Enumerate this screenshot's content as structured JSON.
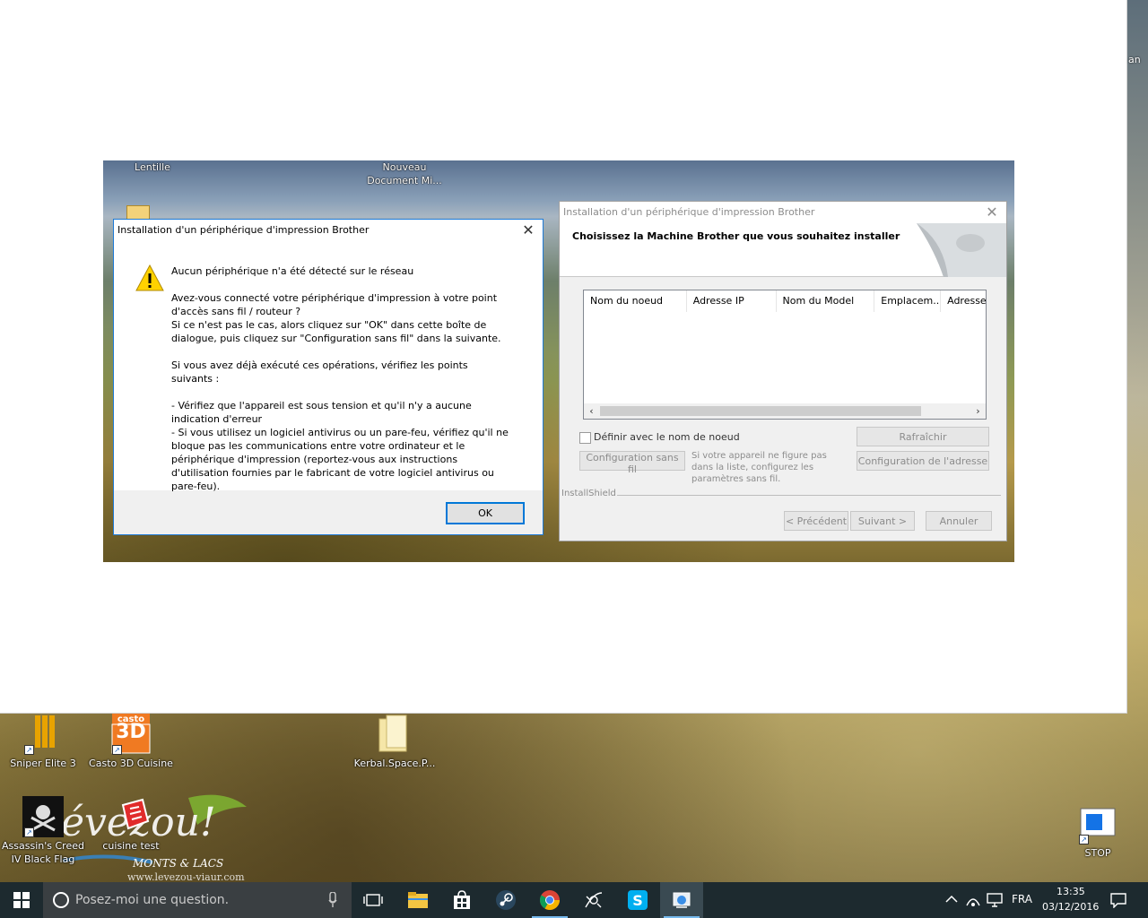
{
  "viewer": {
    "edge_text": "an"
  },
  "inner_desktop": {
    "icon_labels": [
      {
        "name": "Lentille"
      },
      {
        "name": "Nouveau Document Mi..."
      }
    ]
  },
  "message_dialog": {
    "title": "Installation d'un périphérique d'impression Brother",
    "close_glyph": "✕",
    "headline": "Aucun périphérique n'a été détecté sur le réseau",
    "paragraph1": "Avez-vous connecté votre périphérique d'impression à votre point d'accès sans fil / routeur ?\nSi ce n'est pas le cas, alors cliquez sur \"OK\" dans cette boîte de dialogue, puis cliquez sur \"Configuration sans fil\" dans la suivante.",
    "paragraph2": "Si vous avez déjà exécuté ces opérations, vérifiez les points suivants :",
    "paragraph3": "- Vérifiez que l'appareil est sous tension et qu'il n'y a aucune indication d'erreur\n- Si vous utilisez un logiciel antivirus ou un pare-feu, vérifiez qu'il ne bloque pas les communications entre votre ordinateur et le périphérique d'impression (reportez-vous aux instructions d'utilisation fournies par le fabricant de votre logiciel antivirus ou pare-feu).",
    "ok_label": "OK",
    "icon": "warning-icon"
  },
  "wizard": {
    "title": "Installation d'un périphérique d'impression Brother",
    "close_glyph": "✕",
    "heading": "Choisissez la Machine Brother que vous souhaitez installer",
    "columns": [
      "Nom du noeud",
      "Adresse IP",
      "Nom du Model",
      "Emplacem...",
      "Adresse"
    ],
    "checkbox_label": "Définir avec le nom de noeud",
    "refresh_label": "Rafraîchir",
    "wireless_label": "Configuration sans fil",
    "hint": "Si votre appareil ne figure pas dans la liste, configurez les paramètres sans fil.",
    "address_label": "Configuration de l'adresse",
    "brand": "InstallShield",
    "back_label": "< Précédent",
    "next_label": "Suivant >",
    "cancel_label": "Annuler"
  },
  "desktop_icons": [
    {
      "label": "Sniper Elite 3"
    },
    {
      "label": "Casto 3D Cuisine",
      "badge_top": "casto",
      "badge_main": "3D"
    },
    {
      "label": "Kerbal.Space.P..."
    },
    {
      "label": "Assassin's Creed IV Black Flag"
    },
    {
      "label": "cuisine test"
    },
    {
      "label": "STOP"
    }
  ],
  "watermark": {
    "word": "évezou!",
    "sub": "MONTS & LACS",
    "url": "www.levezou-viaur.com"
  },
  "taskbar": {
    "search_placeholder": "Posez-moi une question.",
    "language": "FRA",
    "time": "13:35",
    "date": "03/12/2016"
  }
}
